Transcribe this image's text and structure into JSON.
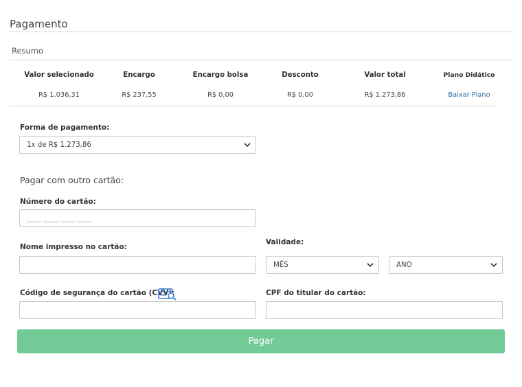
{
  "page": {
    "title": "Pagamento"
  },
  "summary": {
    "section_title": "Resumo",
    "headers": [
      "Valor selecionado",
      "Encargo",
      "Encargo bolsa",
      "Desconto",
      "Valor total",
      "Plano Didático"
    ],
    "values": [
      "R$ 1.036,31",
      "R$ 237,55",
      "R$ 0,00",
      "R$ 0,00",
      "R$ 1.273,86"
    ],
    "plan_link": "Baixar Plano"
  },
  "payment": {
    "method_label": "Forma de pagamento:",
    "method_selected": "1x de R$ 1.273,86"
  },
  "card": {
    "heading": "Pagar com outro cartão:",
    "number_label": "Número do cartão:",
    "number_placeholder": "____ ____ ____ ____",
    "name_label": "Nome impresso no cartão:",
    "validity_label": "Validade:",
    "month_selected": "MÊS",
    "year_selected": "ANO",
    "cvv_label": "Código de segurança do cartão (CVV):",
    "cpf_label": "CPF do titular do cartão:"
  },
  "actions": {
    "pay_label": "Pagar"
  },
  "colors": {
    "accent": "#72ca96",
    "link": "#2f6fa8",
    "icon": "#3b7fd9"
  }
}
